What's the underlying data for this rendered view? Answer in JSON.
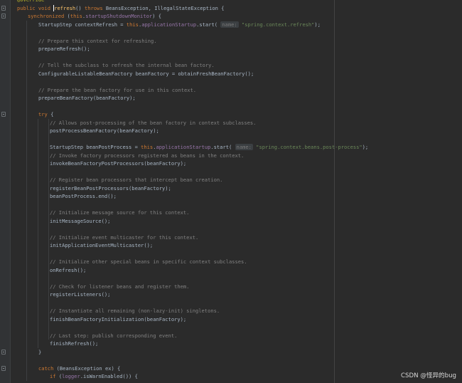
{
  "editor": {
    "language": "java",
    "colors": {
      "background": "#2b2b2b",
      "keyword": "#cc7832",
      "method": "#ffc66d",
      "comment": "#808080",
      "string": "#6a8759",
      "field": "#9876aa",
      "annotation": "#bbb529",
      "default": "#a9b7c6"
    },
    "lines": [
      {
        "indent": 1,
        "tokens": [
          [
            "an",
            "@Override"
          ]
        ]
      },
      {
        "indent": 1,
        "fold": true,
        "tokens": [
          [
            "kw",
            "public void "
          ],
          [
            "caret",
            ""
          ],
          [
            "fn",
            "refresh"
          ],
          [
            "df",
            "() "
          ],
          [
            "kw",
            "throws "
          ],
          [
            "df",
            "BeansException, IllegalStateException {"
          ]
        ]
      },
      {
        "indent": 2,
        "fold": true,
        "tokens": [
          [
            "kw",
            "synchronized "
          ],
          [
            "df",
            "("
          ],
          [
            "kw",
            "this"
          ],
          [
            "df",
            "."
          ],
          [
            "fd",
            "startupShutdownMonitor"
          ],
          [
            "df",
            ") {"
          ]
        ]
      },
      {
        "indent": 3,
        "tokens": [
          [
            "df",
            "StartupStep contextRefresh = "
          ],
          [
            "kw",
            "this"
          ],
          [
            "df",
            "."
          ],
          [
            "fd",
            "applicationStartup"
          ],
          [
            "df",
            ".start( "
          ],
          [
            "hint",
            "name:"
          ],
          [
            "st",
            " \"spring.context.refresh\""
          ],
          [
            "df",
            ");"
          ]
        ]
      },
      {
        "indent": 0,
        "tokens": []
      },
      {
        "indent": 3,
        "tokens": [
          [
            "cm",
            "// Prepare this context for refreshing."
          ]
        ]
      },
      {
        "indent": 3,
        "tokens": [
          [
            "df",
            "prepareRefresh();"
          ]
        ]
      },
      {
        "indent": 0,
        "tokens": []
      },
      {
        "indent": 3,
        "tokens": [
          [
            "cm",
            "// Tell the subclass to refresh the internal bean factory."
          ]
        ]
      },
      {
        "indent": 3,
        "tokens": [
          [
            "df",
            "ConfigurableListableBeanFactory beanFactory = obtainFreshBeanFactory();"
          ]
        ]
      },
      {
        "indent": 0,
        "tokens": []
      },
      {
        "indent": 3,
        "tokens": [
          [
            "cm",
            "// Prepare the bean factory for use in this context."
          ]
        ]
      },
      {
        "indent": 3,
        "tokens": [
          [
            "df",
            "prepareBeanFactory(beanFactory);"
          ]
        ]
      },
      {
        "indent": 0,
        "tokens": []
      },
      {
        "indent": 3,
        "fold": true,
        "tokens": [
          [
            "kw",
            "try "
          ],
          [
            "df",
            "{"
          ]
        ]
      },
      {
        "indent": 4,
        "tokens": [
          [
            "cm",
            "// Allows post-processing of the bean factory in context subclasses."
          ]
        ]
      },
      {
        "indent": 4,
        "tokens": [
          [
            "df",
            "postProcessBeanFactory(beanFactory);"
          ]
        ]
      },
      {
        "indent": 0,
        "tokens": []
      },
      {
        "indent": 4,
        "tokens": [
          [
            "df",
            "StartupStep beanPostProcess = "
          ],
          [
            "kw",
            "this"
          ],
          [
            "df",
            "."
          ],
          [
            "fd",
            "applicationStartup"
          ],
          [
            "df",
            ".start( "
          ],
          [
            "hint",
            "name:"
          ],
          [
            "st",
            " \"spring.context.beans.post-process\""
          ],
          [
            "df",
            ");"
          ]
        ]
      },
      {
        "indent": 4,
        "tokens": [
          [
            "cm",
            "// Invoke factory processors registered as beans in the context."
          ]
        ]
      },
      {
        "indent": 4,
        "tokens": [
          [
            "df",
            "invokeBeanFactoryPostProcessors(beanFactory);"
          ]
        ]
      },
      {
        "indent": 0,
        "tokens": []
      },
      {
        "indent": 4,
        "tokens": [
          [
            "cm",
            "// Register bean processors that intercept bean creation."
          ]
        ]
      },
      {
        "indent": 4,
        "tokens": [
          [
            "df",
            "registerBeanPostProcessors(beanFactory);"
          ]
        ]
      },
      {
        "indent": 4,
        "tokens": [
          [
            "df",
            "beanPostProcess.end();"
          ]
        ]
      },
      {
        "indent": 0,
        "tokens": []
      },
      {
        "indent": 4,
        "tokens": [
          [
            "cm",
            "// Initialize message source for this context."
          ]
        ]
      },
      {
        "indent": 4,
        "tokens": [
          [
            "df",
            "initMessageSource();"
          ]
        ]
      },
      {
        "indent": 0,
        "tokens": []
      },
      {
        "indent": 4,
        "tokens": [
          [
            "cm",
            "// Initialize event multicaster for this context."
          ]
        ]
      },
      {
        "indent": 4,
        "tokens": [
          [
            "df",
            "initApplicationEventMulticaster();"
          ]
        ]
      },
      {
        "indent": 0,
        "tokens": []
      },
      {
        "indent": 4,
        "tokens": [
          [
            "cm",
            "// Initialize other special beans in specific context subclasses."
          ]
        ]
      },
      {
        "indent": 4,
        "tokens": [
          [
            "df",
            "onRefresh();"
          ]
        ]
      },
      {
        "indent": 0,
        "tokens": []
      },
      {
        "indent": 4,
        "tokens": [
          [
            "cm",
            "// Check for listener beans and register them."
          ]
        ]
      },
      {
        "indent": 4,
        "tokens": [
          [
            "df",
            "registerListeners();"
          ]
        ]
      },
      {
        "indent": 0,
        "tokens": []
      },
      {
        "indent": 4,
        "tokens": [
          [
            "cm",
            "// Instantiate all remaining (non-lazy-init) singletons."
          ]
        ]
      },
      {
        "indent": 4,
        "tokens": [
          [
            "df",
            "finishBeanFactoryInitialization(beanFactory);"
          ]
        ]
      },
      {
        "indent": 0,
        "tokens": []
      },
      {
        "indent": 4,
        "tokens": [
          [
            "cm",
            "// Last step: publish corresponding event."
          ]
        ]
      },
      {
        "indent": 4,
        "tokens": [
          [
            "df",
            "finishRefresh();"
          ]
        ]
      },
      {
        "indent": 3,
        "fold": true,
        "tokens": [
          [
            "df",
            "}"
          ]
        ]
      },
      {
        "indent": 0,
        "tokens": []
      },
      {
        "indent": 3,
        "fold": true,
        "tokens": [
          [
            "kw",
            "catch "
          ],
          [
            "df",
            "(BeansException ex) {"
          ]
        ]
      },
      {
        "indent": 4,
        "tokens": [
          [
            "kw",
            "if "
          ],
          [
            "df",
            "("
          ],
          [
            "fd",
            "logger"
          ],
          [
            "df",
            ".isWarnEnabled()) {"
          ]
        ]
      }
    ]
  },
  "watermark": {
    "text": "CSDN @怪异的bug"
  }
}
